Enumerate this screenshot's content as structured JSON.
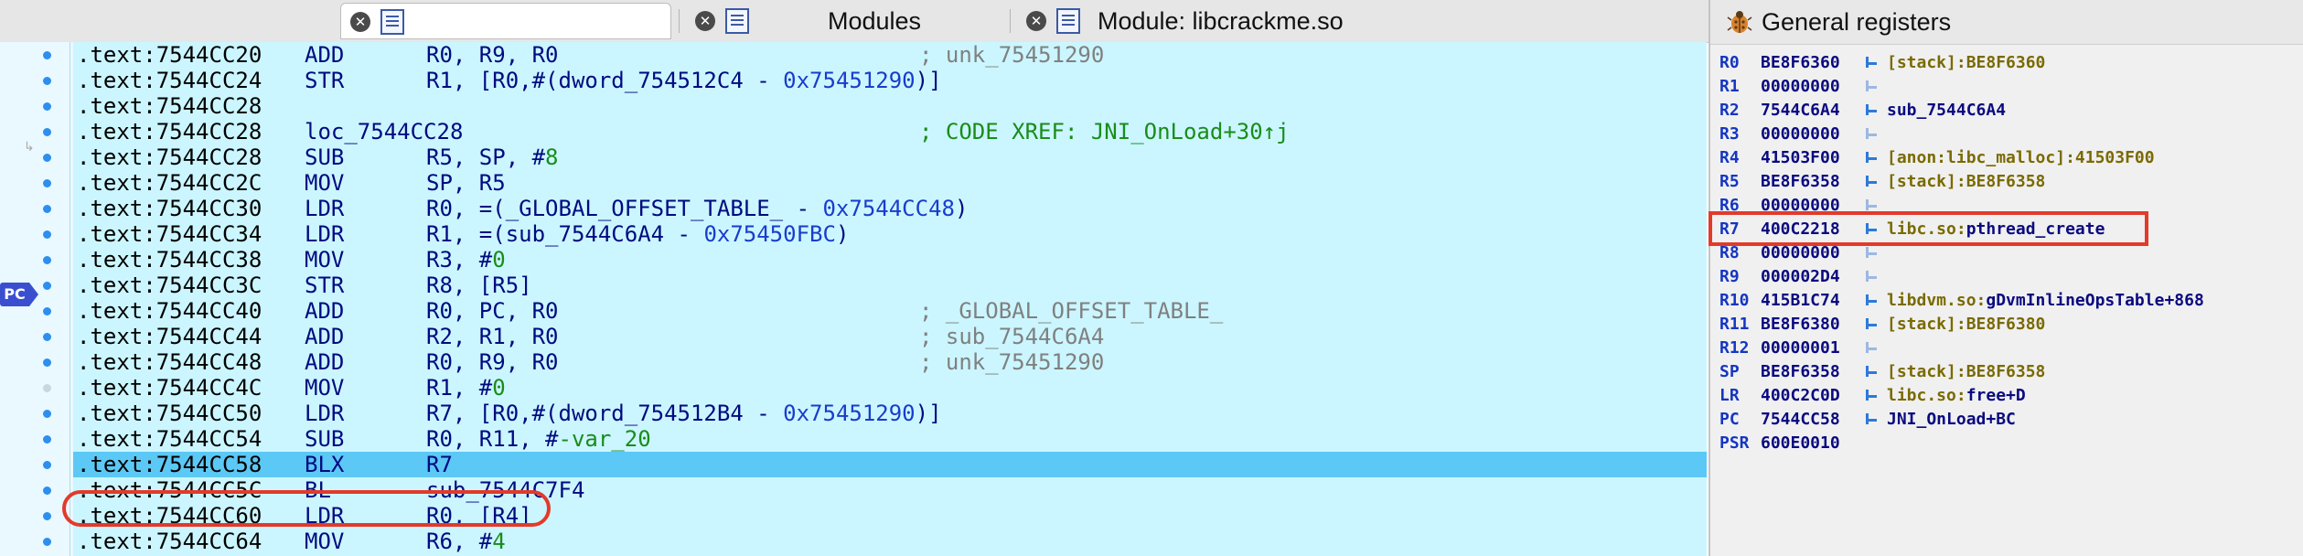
{
  "tabs": [
    {
      "label": "",
      "icon": "document-list-icon"
    },
    {
      "label": "Modules",
      "icon": "modules-icon"
    },
    {
      "label": "Module: libcrackme.so",
      "icon": "document-list-icon"
    }
  ],
  "pc_badge": "PC",
  "disasm": [
    {
      "addr": ".text:7544CC20",
      "mn": "ADD",
      "op": "R0, R9, R0",
      "comment": "; unk_75451290"
    },
    {
      "addr": ".text:7544CC24",
      "mn": "STR",
      "op_parts": [
        "R1, [R0,#(dword_754512C4 - ",
        "0x75451290",
        ")]"
      ]
    },
    {
      "addr": ".text:7544CC28"
    },
    {
      "addr": ".text:7544CC28",
      "label": "loc_7544CC28",
      "comment": "; CODE XREF: JNI_OnLoad+30↑j"
    },
    {
      "addr": ".text:7544CC28",
      "mn": "SUB",
      "op_parts": [
        "R5, SP, #",
        "8"
      ]
    },
    {
      "addr": ".text:7544CC2C",
      "mn": "MOV",
      "op": "SP, R5"
    },
    {
      "addr": ".text:7544CC30",
      "mn": "LDR",
      "op_parts": [
        "R0, =(_GLOBAL_OFFSET_TABLE_ - ",
        "0x7544CC48",
        ")"
      ]
    },
    {
      "addr": ".text:7544CC34",
      "mn": "LDR",
      "op_parts": [
        "R1, =(sub_7544C6A4 - ",
        "0x75450FBC",
        ")"
      ]
    },
    {
      "addr": ".text:7544CC38",
      "mn": "MOV",
      "op_parts": [
        "R3, #",
        "0"
      ]
    },
    {
      "addr": ".text:7544CC3C",
      "mn": "STR",
      "op": "R8, [R5]"
    },
    {
      "addr": ".text:7544CC40",
      "mn": "ADD",
      "op": "R0, PC, R0",
      "comment": "; _GLOBAL_OFFSET_TABLE_"
    },
    {
      "addr": ".text:7544CC44",
      "mn": "ADD",
      "op": "R2, R1, R0",
      "comment": "; sub_7544C6A4"
    },
    {
      "addr": ".text:7544CC48",
      "mn": "ADD",
      "op": "R0, R9, R0",
      "comment": "; unk_75451290"
    },
    {
      "addr": ".text:7544CC4C",
      "mn": "MOV",
      "op_parts": [
        "R1, #",
        "0"
      ]
    },
    {
      "addr": ".text:7544CC50",
      "mn": "LDR",
      "op_parts": [
        "R7, [R0,#(dword_754512B4 - ",
        "0x75451290",
        ")]"
      ]
    },
    {
      "addr": ".text:7544CC54",
      "mn": "SUB",
      "op_parts": [
        "R0, R11, #",
        "-var_20"
      ]
    },
    {
      "addr": ".text:7544CC58",
      "mn": "BLX",
      "op": "R7",
      "current": true
    },
    {
      "addr": ".text:7544CC5C",
      "mn": "BL",
      "op": "sub_7544C7F4"
    },
    {
      "addr": ".text:7544CC60",
      "mn": "LDR",
      "op": "R0, [R4]"
    },
    {
      "addr": ".text:7544CC64",
      "mn": "MOV",
      "op_parts": [
        "R6, #",
        "4"
      ]
    }
  ],
  "registers_panel": {
    "title": "General registers",
    "icon": "bug-icon",
    "registers": [
      {
        "name": "R0",
        "value": "BE8F6360",
        "desc": "[stack]:BE8F6360"
      },
      {
        "name": "R1",
        "value": "00000000",
        "desc": ""
      },
      {
        "name": "R2",
        "value": "7544C6A4",
        "desc": "sub_7544C6A4",
        "sym": true
      },
      {
        "name": "R3",
        "value": "00000000",
        "desc": ""
      },
      {
        "name": "R4",
        "value": "41503F00",
        "desc": "[anon:libc_malloc]:41503F00"
      },
      {
        "name": "R5",
        "value": "BE8F6358",
        "desc": "[stack]:BE8F6358"
      },
      {
        "name": "R6",
        "value": "00000000",
        "desc": ""
      },
      {
        "name": "R7",
        "value": "400C2218",
        "desc_lib": "libc.so:",
        "desc_sym": "pthread_create",
        "highlight": true
      },
      {
        "name": "R8",
        "value": "00000000",
        "desc": ""
      },
      {
        "name": "R9",
        "value": "000002D4",
        "desc": ""
      },
      {
        "name": "R10",
        "value": "415B1C74",
        "desc_lib": "libdvm.so:",
        "desc_sym": "gDvmInlineOpsTable+868"
      },
      {
        "name": "R11",
        "value": "BE8F6380",
        "desc": "[stack]:BE8F6380"
      },
      {
        "name": "R12",
        "value": "00000001",
        "desc": ""
      },
      {
        "name": "SP",
        "value": "BE8F6358",
        "desc": "[stack]:BE8F6358"
      },
      {
        "name": "LR",
        "value": "400C2C0D",
        "desc_lib": "libc.so:",
        "desc_sym": "free+D"
      },
      {
        "name": "PC",
        "value": "7544CC58",
        "desc": "JNI_OnLoad+BC",
        "sym": true
      },
      {
        "name": "PSR",
        "value": "600E0010",
        "desc": "",
        "no_arrow": true
      }
    ]
  }
}
